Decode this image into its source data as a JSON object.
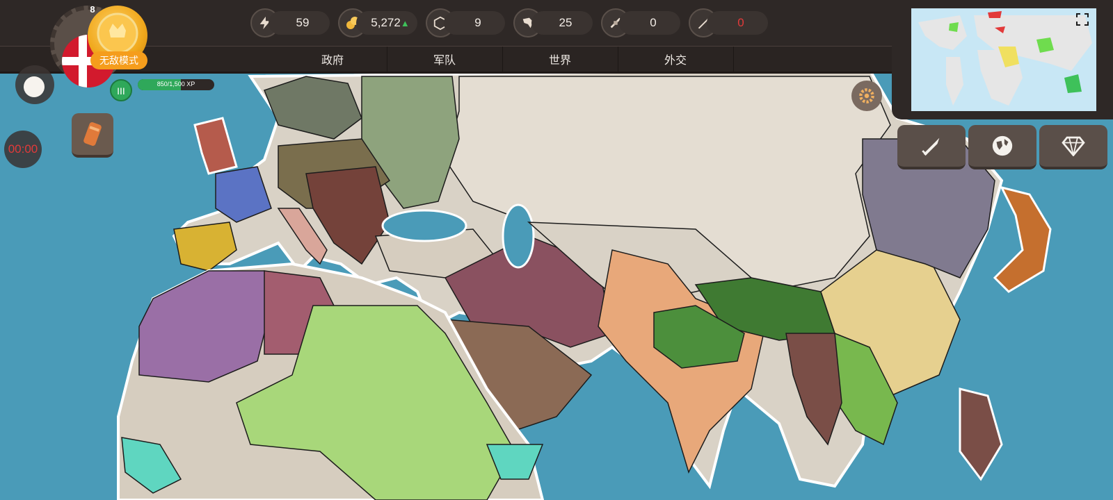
{
  "resources": [
    {
      "icon": "lightning-icon",
      "value": "59"
    },
    {
      "icon": "gold-coins-icon",
      "value": "5,272",
      "trend": "up"
    },
    {
      "icon": "factory-icon",
      "value": "9"
    },
    {
      "icon": "fist-icon",
      "value": "25"
    },
    {
      "icon": "satellite-icon",
      "value": "0"
    },
    {
      "icon": "missile-icon",
      "value": "0",
      "color": "#e23a3a"
    }
  ],
  "tabs": [
    "政府",
    "军队",
    "世界",
    "外交"
  ],
  "player": {
    "level": "8",
    "mode_label": "无敌模式",
    "rank": "III",
    "xp_text": "850/1,500 XP",
    "xp_fraction": 0.567,
    "flag": "denmark-flag"
  },
  "timer": "00:00",
  "side_buttons": [
    "sword-icon",
    "globe-icon",
    "diamond-icon"
  ],
  "colors": {
    "ocean": "#4a9bb8",
    "land_default": "#d9d2c6",
    "accent_gold": "#f59d1c",
    "timer_red": "#e23a3a"
  }
}
